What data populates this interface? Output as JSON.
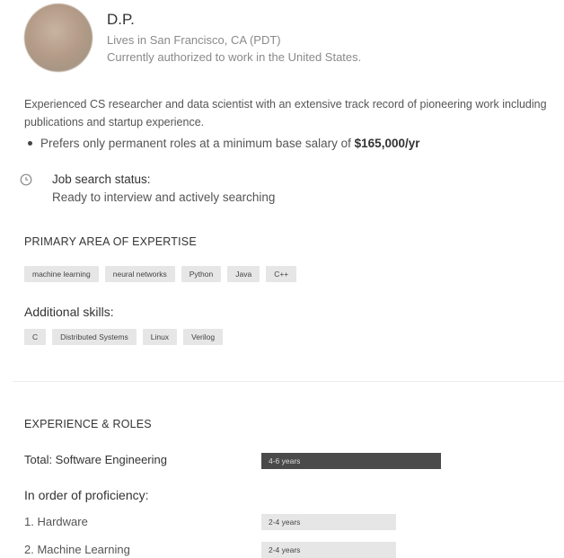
{
  "profile": {
    "name": "D.P.",
    "location": "Lives in San Francisco, CA (PDT)",
    "authorization": "Currently authorized to work in the United States."
  },
  "bio": "Experienced CS researcher and data scientist with an extensive track record of pioneering work including publications and startup experience.",
  "preference": {
    "prefix": "Prefers only permanent roles at a minimum base salary of ",
    "salary": "$165,000/yr"
  },
  "job_search": {
    "label": "Job search status:",
    "value": "Ready to interview and actively searching",
    "icon": "clock-icon"
  },
  "primary_expertise": {
    "title": "PRIMARY AREA OF EXPERTISE",
    "skills": [
      "machine learning",
      "neural networks",
      "Python",
      "Java",
      "C++"
    ]
  },
  "additional_skills": {
    "title": "Additional skills:",
    "skills": [
      "C",
      "Distributed Systems",
      "Linux",
      "Verilog"
    ]
  },
  "experience": {
    "title": "EXPERIENCE & ROLES",
    "total_label": "Total: Software Engineering",
    "total_years": "4-6 years",
    "order_label": "In order of proficiency:",
    "roles": [
      {
        "index": "1.",
        "name": "Hardware",
        "years": "2-4 years"
      },
      {
        "index": "2.",
        "name": "Machine Learning",
        "years": "2-4 years"
      }
    ]
  },
  "colors": {
    "chip_bg": "#e6e6e6",
    "bar_dark": "#4a4a4a",
    "bar_light": "#e6e6e6"
  }
}
